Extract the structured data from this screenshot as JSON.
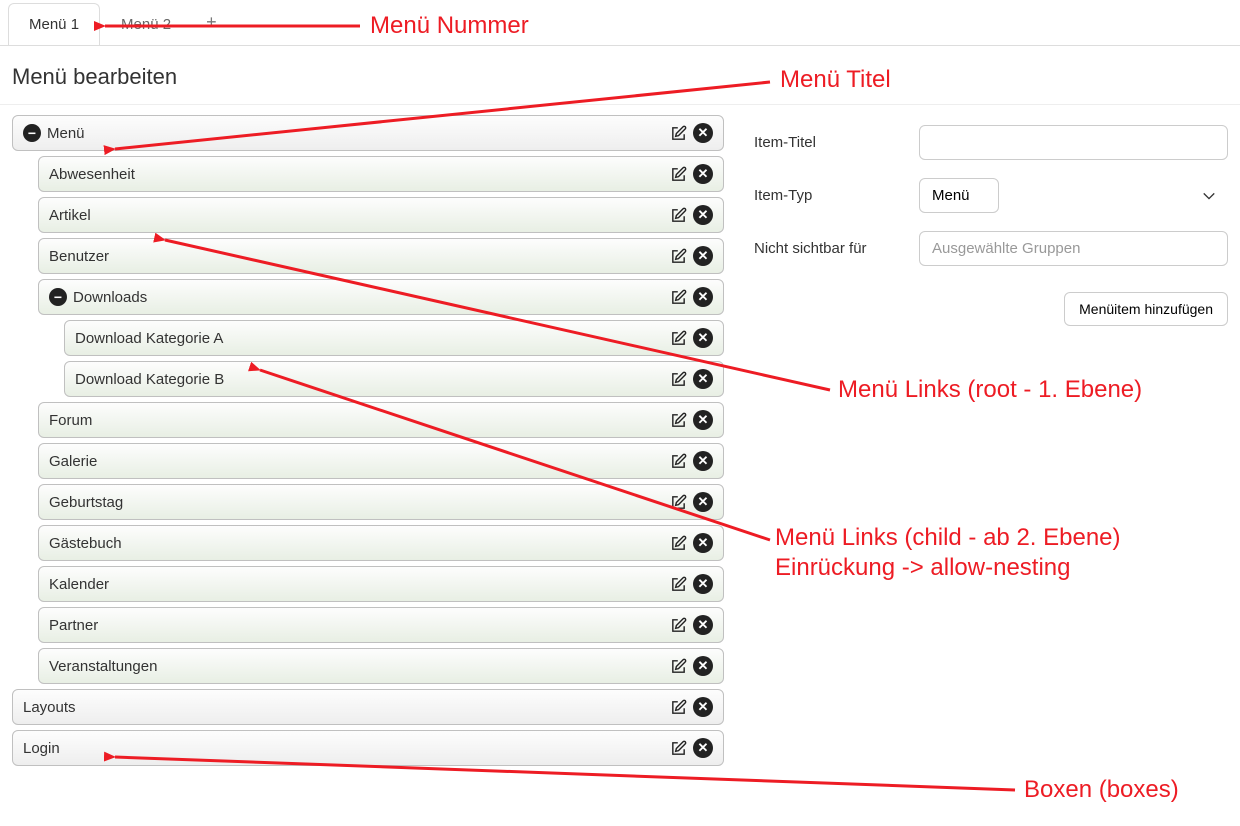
{
  "tabs": {
    "tab1": "Menü 1",
    "tab2": "Menü 2",
    "add": "+"
  },
  "pageTitle": "Menü bearbeiten",
  "tree": {
    "root": "Menü",
    "items": {
      "abwesenheit": "Abwesenheit",
      "artikel": "Artikel",
      "benutzer": "Benutzer",
      "downloads": "Downloads",
      "downloadA": "Download Kategorie A",
      "downloadB": "Download Kategorie B",
      "forum": "Forum",
      "galerie": "Galerie",
      "geburtstag": "Geburtstag",
      "gaestebuch": "Gästebuch",
      "kalender": "Kalender",
      "partner": "Partner",
      "veranstaltungen": "Veranstaltungen",
      "layouts": "Layouts",
      "login": "Login"
    }
  },
  "form": {
    "itemTitleLabel": "Item-Titel",
    "itemTypeLabel": "Item-Typ",
    "itemTypeValue": "Menü",
    "hiddenForLabel": "Nicht sichtbar für",
    "hiddenForPlaceholder": "Ausgewählte Gruppen",
    "addButton": "Menüitem hinzufügen"
  },
  "annotations": {
    "nummer": "Menü Nummer",
    "titel": "Menü Titel",
    "linksRoot": "Menü Links (root - 1. Ebene)",
    "linksChild1": "Menü Links (child - ab 2. Ebene)",
    "linksChild2": "Einrückung -> allow-nesting",
    "boxen": "Boxen (boxes)"
  }
}
